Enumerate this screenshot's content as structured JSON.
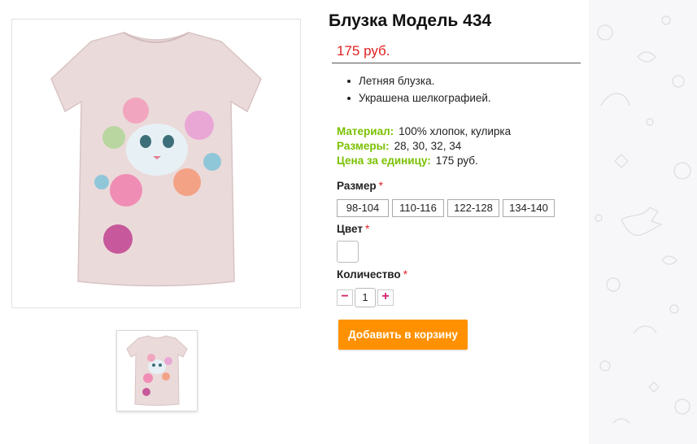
{
  "product": {
    "title": "Блузка Модель 434",
    "price": "175 руб.",
    "features": [
      "Летняя блузка.",
      "Украшена шелкографией."
    ],
    "specs": [
      {
        "label": "Материал:",
        "value": "100% хлопок, кулирка"
      },
      {
        "label": "Размеры:",
        "value": "28, 30, 32, 34"
      },
      {
        "label": "Цена за единицу:",
        "value": "175 руб."
      }
    ]
  },
  "options": {
    "size_label": "Размер",
    "required_mark": "*",
    "sizes": [
      "98-104",
      "110-116",
      "122-128",
      "134-140"
    ],
    "color_label": "Цвет",
    "quantity_label": "Количество",
    "quantity_value": "1",
    "minus": "−",
    "plus": "+"
  },
  "cart": {
    "add_label": "Добавить в корзину"
  },
  "colors": {
    "price": "#e01f1f",
    "spec_label": "#7ac100",
    "cart_button": "#ff9100",
    "qty_sign": "#d6206c"
  },
  "images": {
    "main": "tshirt-cat-flowers-image",
    "thumb": "tshirt-cat-flowers-thumbnail"
  }
}
